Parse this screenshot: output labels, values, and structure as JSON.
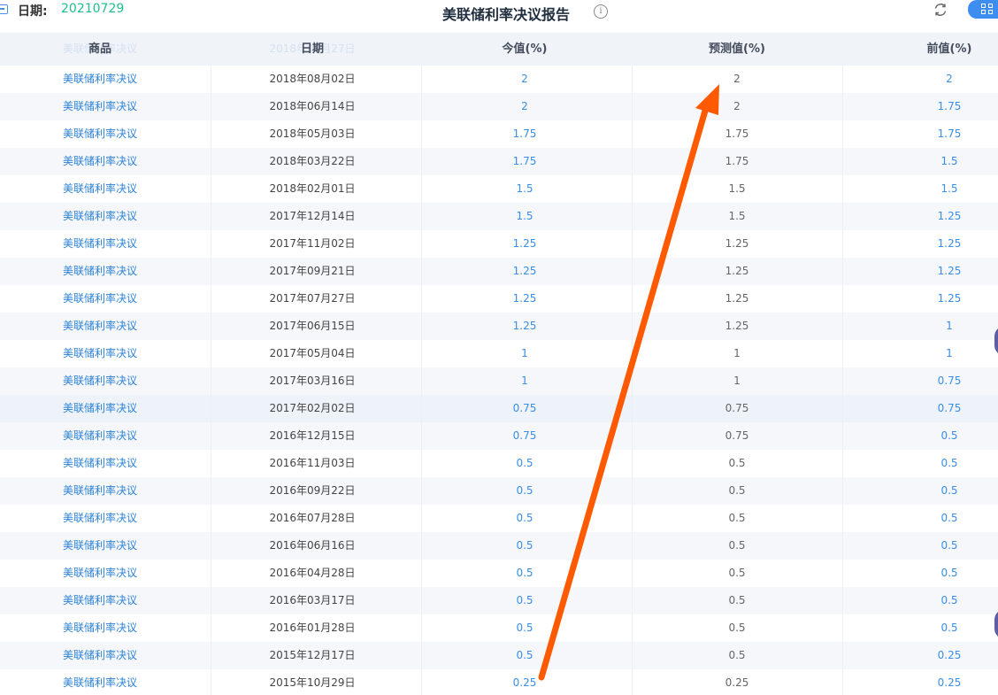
{
  "header": {
    "date_label": "日期:",
    "date_value": "20210729",
    "title": "美联储利率决议报告",
    "info_icon": "info-icon",
    "refresh_icon": "refresh-icon",
    "layout_icon": "grid-icon"
  },
  "table": {
    "columns": [
      "商品",
      "日期",
      "今值(%)",
      "预测值(%)",
      "前值(%)"
    ],
    "ghost_row": {
      "name": "美联储利率决议",
      "date": "2018年09月27日"
    },
    "rows": [
      {
        "name": "美联储利率决议",
        "date": "2018年08月02日",
        "now": "2",
        "forecast": "2",
        "prev": "2"
      },
      {
        "name": "美联储利率决议",
        "date": "2018年06月14日",
        "now": "2",
        "forecast": "2",
        "prev": "1.75"
      },
      {
        "name": "美联储利率决议",
        "date": "2018年05月03日",
        "now": "1.75",
        "forecast": "1.75",
        "prev": "1.75"
      },
      {
        "name": "美联储利率决议",
        "date": "2018年03月22日",
        "now": "1.75",
        "forecast": "1.75",
        "prev": "1.5"
      },
      {
        "name": "美联储利率决议",
        "date": "2018年02月01日",
        "now": "1.5",
        "forecast": "1.5",
        "prev": "1.5"
      },
      {
        "name": "美联储利率决议",
        "date": "2017年12月14日",
        "now": "1.5",
        "forecast": "1.5",
        "prev": "1.25"
      },
      {
        "name": "美联储利率决议",
        "date": "2017年11月02日",
        "now": "1.25",
        "forecast": "1.25",
        "prev": "1.25"
      },
      {
        "name": "美联储利率决议",
        "date": "2017年09月21日",
        "now": "1.25",
        "forecast": "1.25",
        "prev": "1.25"
      },
      {
        "name": "美联储利率决议",
        "date": "2017年07月27日",
        "now": "1.25",
        "forecast": "1.25",
        "prev": "1.25"
      },
      {
        "name": "美联储利率决议",
        "date": "2017年06月15日",
        "now": "1.25",
        "forecast": "1.25",
        "prev": "1"
      },
      {
        "name": "美联储利率决议",
        "date": "2017年05月04日",
        "now": "1",
        "forecast": "1",
        "prev": "1"
      },
      {
        "name": "美联储利率决议",
        "date": "2017年03月16日",
        "now": "1",
        "forecast": "1",
        "prev": "0.75"
      },
      {
        "name": "美联储利率决议",
        "date": "2017年02月02日",
        "now": "0.75",
        "forecast": "0.75",
        "prev": "0.75"
      },
      {
        "name": "美联储利率决议",
        "date": "2016年12月15日",
        "now": "0.75",
        "forecast": "0.75",
        "prev": "0.5"
      },
      {
        "name": "美联储利率决议",
        "date": "2016年11月03日",
        "now": "0.5",
        "forecast": "0.5",
        "prev": "0.5"
      },
      {
        "name": "美联储利率决议",
        "date": "2016年09月22日",
        "now": "0.5",
        "forecast": "0.5",
        "prev": "0.5"
      },
      {
        "name": "美联储利率决议",
        "date": "2016年07月28日",
        "now": "0.5",
        "forecast": "0.5",
        "prev": "0.5"
      },
      {
        "name": "美联储利率决议",
        "date": "2016年06月16日",
        "now": "0.5",
        "forecast": "0.5",
        "prev": "0.5"
      },
      {
        "name": "美联储利率决议",
        "date": "2016年04月28日",
        "now": "0.5",
        "forecast": "0.5",
        "prev": "0.5"
      },
      {
        "name": "美联储利率决议",
        "date": "2016年03月17日",
        "now": "0.5",
        "forecast": "0.5",
        "prev": "0.5"
      },
      {
        "name": "美联储利率决议",
        "date": "2016年01月28日",
        "now": "0.5",
        "forecast": "0.5",
        "prev": "0.5"
      },
      {
        "name": "美联储利率决议",
        "date": "2015年12月17日",
        "now": "0.5",
        "forecast": "0.5",
        "prev": "0.25"
      },
      {
        "name": "美联储利率决议",
        "date": "2015年10月29日",
        "now": "0.25",
        "forecast": "0.25",
        "prev": "0.25"
      }
    ]
  },
  "colors": {
    "accent": "#3a8ee6",
    "date_value": "#1fbf8f",
    "annotation_arrow": "#ff5a00",
    "header_bg": "#f0f3f8"
  }
}
